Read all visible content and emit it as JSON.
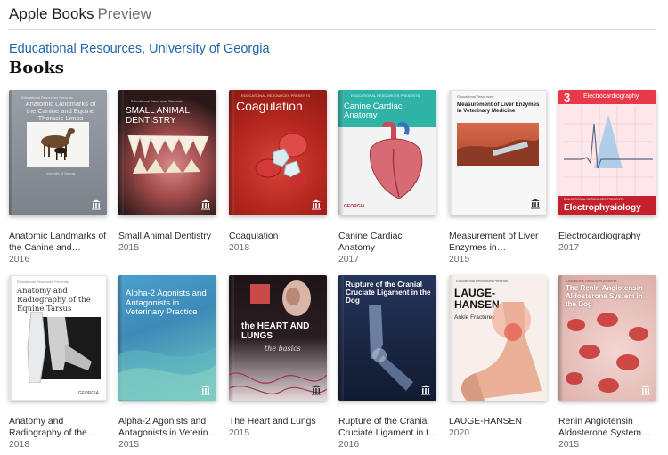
{
  "header": {
    "brand": "Apple Books",
    "subtitle": "Preview"
  },
  "publisher": "Educational Resources, University of Georgia",
  "section_title": "Books",
  "books": [
    {
      "title": "Anatomic Landmarks of the Canine and Equine Thoracic Limbs",
      "display": "Anatomic Landmarks of the Canine and Equine…",
      "year": "2016",
      "cover_text": "Anatomic Landmarks of the Canine and Equine Thoracic Limbs",
      "cover_small": "Educational Resources Presents",
      "cover_footer": "University of Georgia",
      "color": "#8e949b"
    },
    {
      "title": "Small Animal Dentistry",
      "display": "Small Animal Dentistry",
      "year": "2015",
      "cover_text": "SMALL ANIMAL DENTISTRY",
      "cover_small": "Educational Resources Presents",
      "color": "#3a2a2a"
    },
    {
      "title": "Coagulation",
      "display": "Coagulation",
      "year": "2018",
      "cover_text": "Coagulation",
      "cover_small": "EDUCATIONAL RESOURCES PRESENTS",
      "color": "#b82a22"
    },
    {
      "title": "Canine Cardiac Anatomy",
      "display": "Canine Cardiac Anatomy",
      "year": "2017",
      "cover_text": "Canine Cardiac Anatomy",
      "cover_small": "EDUCATIONAL RESOURCES PRESENTS",
      "cover_footer": "GEORGIA",
      "color": "#2bb3a4"
    },
    {
      "title": "Measurement of Liver Enzymes in Veterinary Medicine",
      "display": "Measurement of Liver Enzymes in Veterinary…",
      "year": "2015",
      "cover_text": "Measurement of Liver Enzymes in Veterinary Medicine",
      "cover_small": "Educational Resources",
      "color": "#f4f4f4"
    },
    {
      "title": "Electrocardiography",
      "display": "Electrocardiography",
      "year": "2017",
      "cover_text": "Electrocardiography",
      "cover_number": "3",
      "cover_footer": "Electrophysiology",
      "cover_small": "EDUCATIONAL RESOURCES PRESENTS",
      "color": "#e8394a"
    },
    {
      "title": "Anatomy and Radiography of the Equine Tarsus",
      "display": "Anatomy and Radiography of the Eq…",
      "year": "2018",
      "cover_text": "Anatomy and Radiography of the Equine Tarsus",
      "cover_small": "Educational Resources Presents",
      "cover_footer": "GEORGIA",
      "color": "#ffffff"
    },
    {
      "title": "Alpha-2 Agonists and Antagonists in Veterinary Practice",
      "display": "Alpha-2 Agonists and Antagonists in Veterin…",
      "year": "2015",
      "cover_text": "Alpha-2 Agonists and Antagonists in Veterinary Practice",
      "color": "#3d8ab8"
    },
    {
      "title": "The Heart and Lungs",
      "display": "The Heart and Lungs",
      "year": "2015",
      "cover_text": "the HEART AND LUNGS",
      "cover_sub": "the basics",
      "color": "#2a1d22"
    },
    {
      "title": "Rupture of the Cranial Cruciate Ligament in the Dog",
      "display": "Rupture of the Cranial Cruciate Ligament in t…",
      "year": "2016",
      "cover_text": "Rupture of the Cranial Cruciate Ligament in the Dog",
      "color": "#1d2a4a"
    },
    {
      "title": "LAUGE-HANSEN",
      "display": "LAUGE-HANSEN",
      "year": "2020",
      "cover_text": "LAUGE-HANSEN",
      "cover_sub": "Ankle Fractures",
      "cover_small": "Educational Resources Presents",
      "color": "#f3e9e4"
    },
    {
      "title": "Renin Angiotensin Aldosterone System in the Dog",
      "display": "Renin Angiotensin Aldosterone System in…",
      "year": "2015",
      "cover_text": "The Renin Angiotensin Aldosterone System in the Dog",
      "cover_small": "Educational Resources presents",
      "color": "#e9c8c2"
    }
  ]
}
